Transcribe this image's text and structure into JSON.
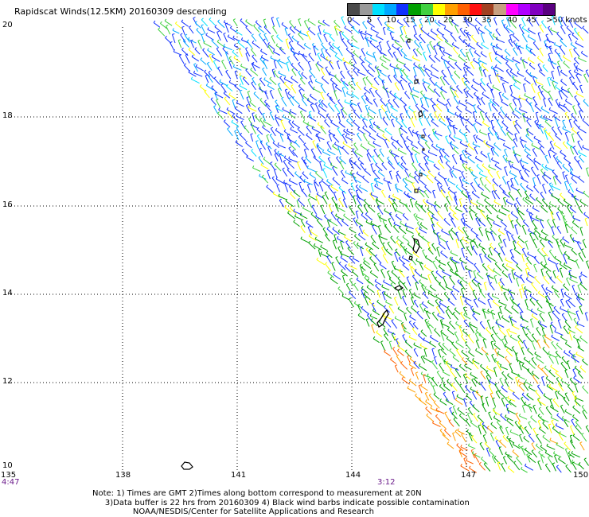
{
  "title": "Rapidscat Winds(12.5KM) 20160309 descending",
  "legend": {
    "colors": [
      "#4a4a4a",
      "#9a9a9a",
      "#00e0ff",
      "#00a8ff",
      "#1030ff",
      "#00a000",
      "#40d040",
      "#ffff00",
      "#ffa000",
      "#ff6000",
      "#ff1010",
      "#a04020",
      "#c8a080",
      "#ff00ff",
      "#b000ff",
      "#8000c0",
      "#5a0080"
    ],
    "labels": [
      "0",
      "5",
      "10",
      "15",
      "20",
      "25",
      "30",
      "35",
      "40",
      "45",
      ">50 knots"
    ]
  },
  "axes": {
    "lat_labels": [
      "20",
      "18",
      "16",
      "14",
      "12",
      "10"
    ],
    "lon_labels": [
      "135",
      "138",
      "141",
      "144",
      "147",
      "150"
    ]
  },
  "times": {
    "left": "4:47",
    "middle": "3:12"
  },
  "notes": {
    "line1": "Note: 1) Times are GMT 2)Times along bottom correspond to measurement at 20N",
    "line2": "3)Data buffer is 22 hrs from 20160309 4) Black wind barbs indicate possible contamination",
    "line3": "NOAA/NESDIS/Center for Satellite Applications and Research"
  }
}
